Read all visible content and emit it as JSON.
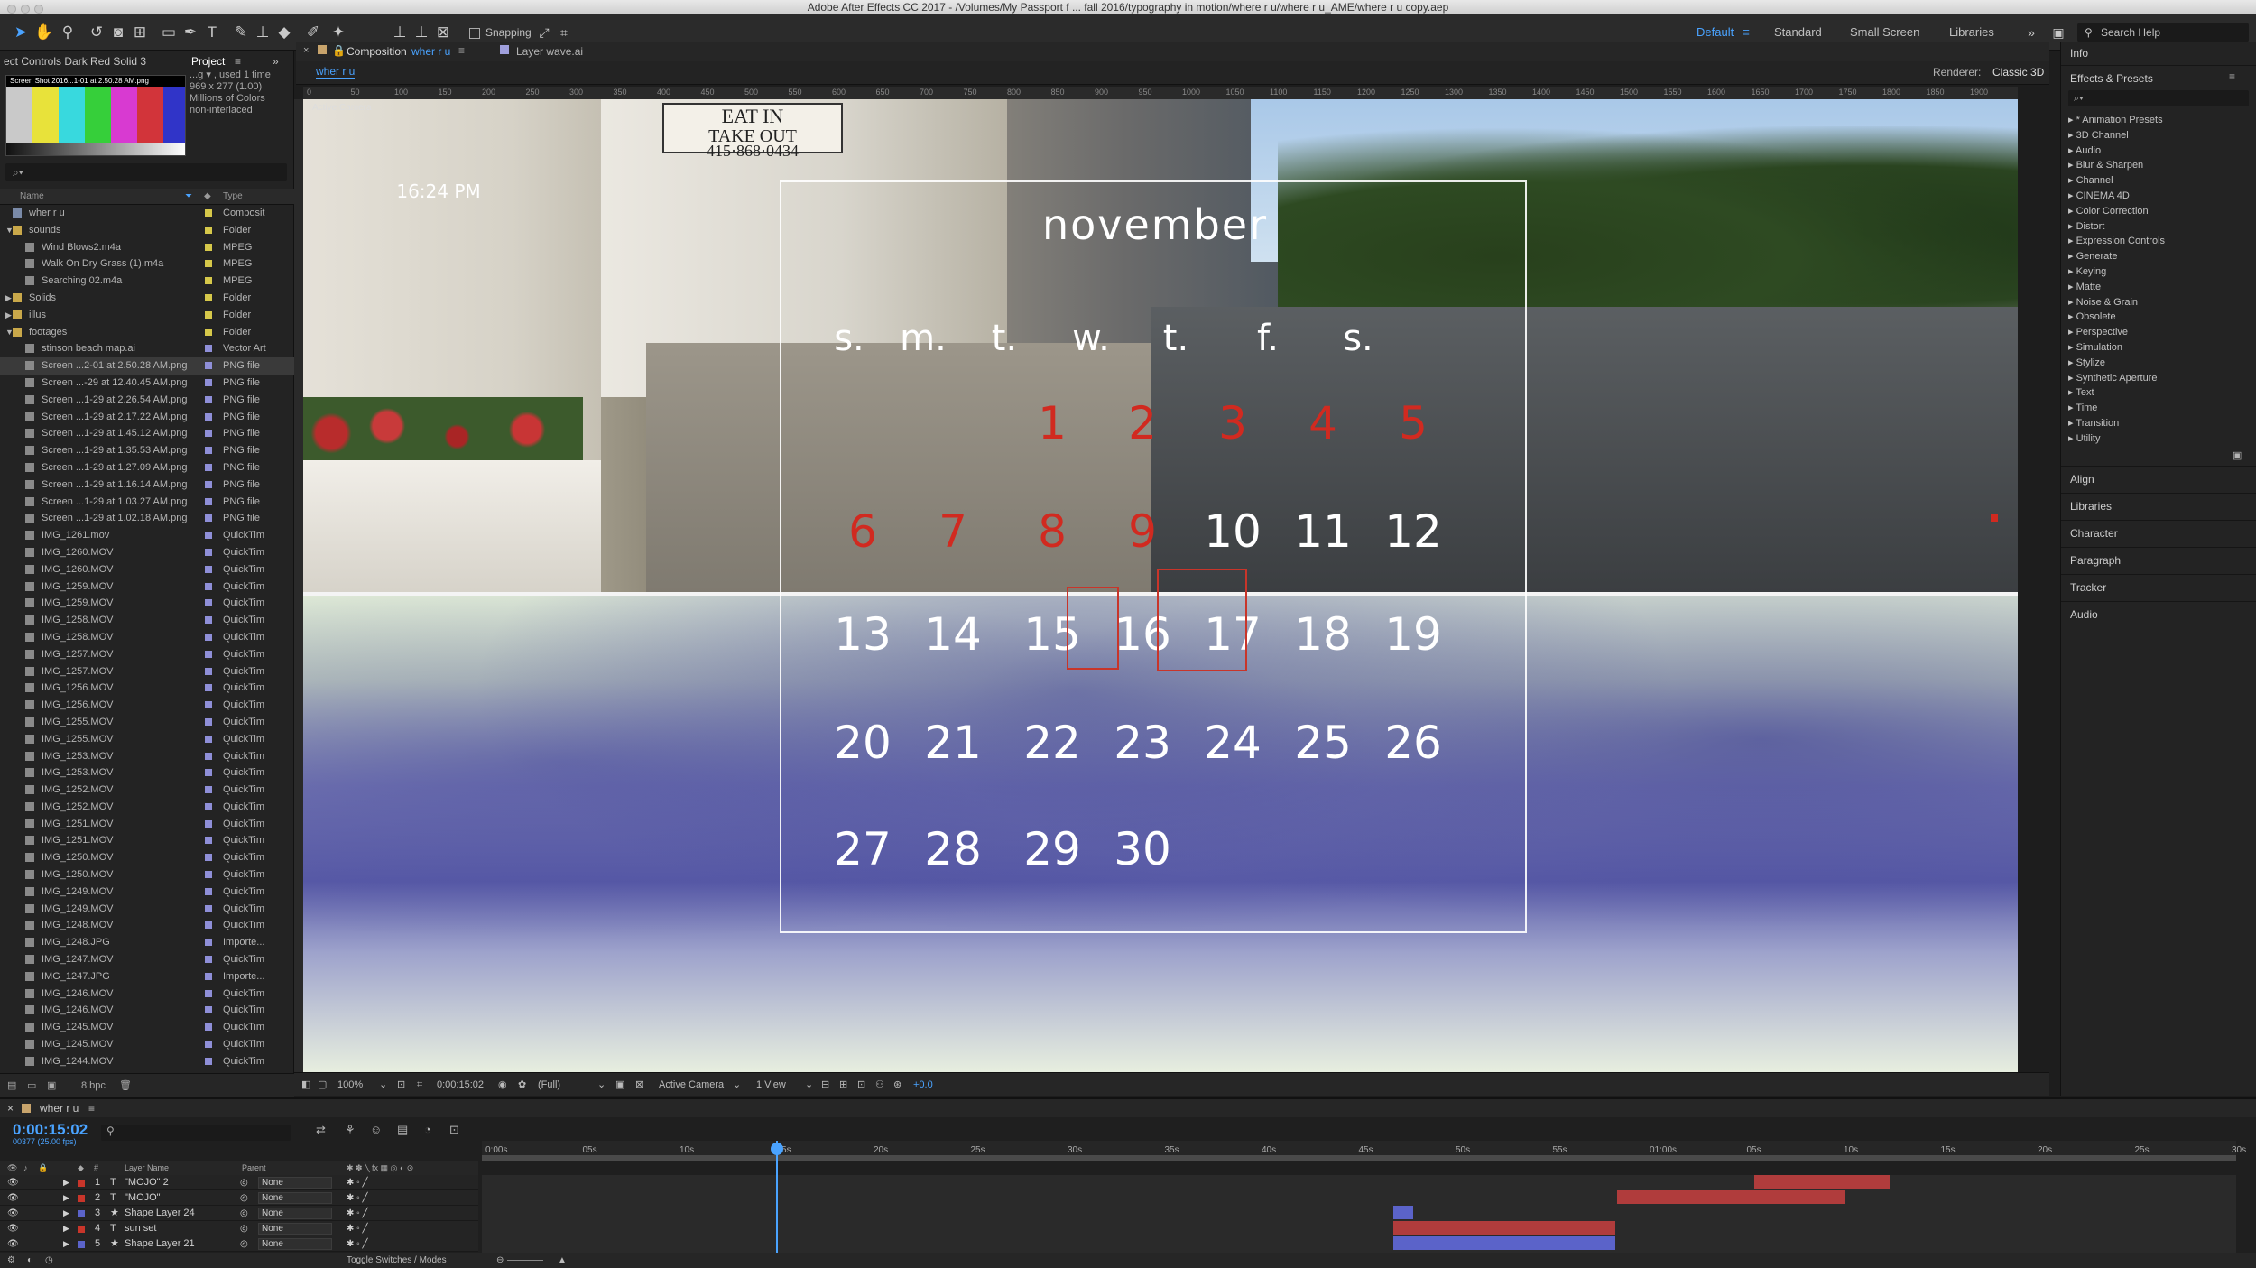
{
  "titlebar": {
    "title": "Adobe After Effects CC 2017 - /Volumes/My Passport f ... fall 2016/typography in motion/where r u/where r u_AME/where r u copy.aep"
  },
  "toolbar": {
    "snapping_label": "Snapping",
    "workspaces": [
      "Default",
      "Standard",
      "Small Screen",
      "Libraries"
    ],
    "active_workspace": "Default",
    "search_placeholder": "Search Help"
  },
  "left_panel": {
    "effect_controls_tab": "ect Controls Dark Red Solid 3",
    "project_tab": "Project",
    "thumb_name": "Screen Shot 2016...1-01 at 2.50.28 AM.png",
    "info_lines": [
      "...g ▾ , used 1 time",
      "969 x 277 (1.00)",
      "",
      "Millions of Colors",
      "non-interlaced"
    ],
    "search_placeholder": "⌕▾",
    "col_name": "Name",
    "col_type": "Type",
    "bpc": "8 bpc",
    "items": [
      {
        "name": "wher r u",
        "type": "Composit",
        "color": "#d6c84a",
        "icon": "comp-icon",
        "indent": 0,
        "twirl": ""
      },
      {
        "name": "sounds",
        "type": "Folder",
        "color": "#d6c84a",
        "icon": "folder-icon",
        "indent": 0,
        "twirl": "▼"
      },
      {
        "name": "Wind Blows2.m4a",
        "type": "MPEG",
        "color": "#d6c84a",
        "icon": "audio-icon",
        "indent": 1,
        "twirl": ""
      },
      {
        "name": "Walk On Dry Grass (1).m4a",
        "type": "MPEG",
        "color": "#d6c84a",
        "icon": "audio-icon",
        "indent": 1,
        "twirl": ""
      },
      {
        "name": "Searching 02.m4a",
        "type": "MPEG",
        "color": "#d6c84a",
        "icon": "audio-icon",
        "indent": 1,
        "twirl": ""
      },
      {
        "name": "Solids",
        "type": "Folder",
        "color": "#d6c84a",
        "icon": "folder-icon",
        "indent": 0,
        "twirl": "▶"
      },
      {
        "name": "illus",
        "type": "Folder",
        "color": "#d6c84a",
        "icon": "folder-icon",
        "indent": 0,
        "twirl": "▶"
      },
      {
        "name": "footages",
        "type": "Folder",
        "color": "#d6c84a",
        "icon": "folder-icon",
        "indent": 0,
        "twirl": "▼"
      },
      {
        "name": "stinson beach map.ai",
        "type": "Vector Art",
        "color": "#8f8fd8",
        "icon": "vector-icon",
        "indent": 1,
        "twirl": ""
      },
      {
        "name": "Screen ...2-01 at 2.50.28 AM.png",
        "type": "PNG file",
        "color": "#8f8fd8",
        "icon": "image-icon",
        "indent": 1,
        "twirl": "",
        "hl": true
      },
      {
        "name": "Screen ...-29 at 12.40.45 AM.png",
        "type": "PNG file",
        "color": "#8f8fd8",
        "icon": "image-icon",
        "indent": 1,
        "twirl": ""
      },
      {
        "name": "Screen ...1-29 at 2.26.54 AM.png",
        "type": "PNG file",
        "color": "#8f8fd8",
        "icon": "image-icon",
        "indent": 1,
        "twirl": ""
      },
      {
        "name": "Screen ...1-29 at 2.17.22 AM.png",
        "type": "PNG file",
        "color": "#8f8fd8",
        "icon": "image-icon",
        "indent": 1,
        "twirl": ""
      },
      {
        "name": "Screen ...1-29 at 1.45.12 AM.png",
        "type": "PNG file",
        "color": "#8f8fd8",
        "icon": "image-icon",
        "indent": 1,
        "twirl": ""
      },
      {
        "name": "Screen ...1-29 at 1.35.53 AM.png",
        "type": "PNG file",
        "color": "#8f8fd8",
        "icon": "image-icon",
        "indent": 1,
        "twirl": ""
      },
      {
        "name": "Screen ...1-29 at 1.27.09 AM.png",
        "type": "PNG file",
        "color": "#8f8fd8",
        "icon": "image-icon",
        "indent": 1,
        "twirl": ""
      },
      {
        "name": "Screen ...1-29 at 1.16.14 AM.png",
        "type": "PNG file",
        "color": "#8f8fd8",
        "icon": "image-icon",
        "indent": 1,
        "twirl": ""
      },
      {
        "name": "Screen ...1-29 at 1.03.27 AM.png",
        "type": "PNG file",
        "color": "#8f8fd8",
        "icon": "image-icon",
        "indent": 1,
        "twirl": ""
      },
      {
        "name": "Screen ...1-29 at 1.02.18 AM.png",
        "type": "PNG file",
        "color": "#8f8fd8",
        "icon": "image-icon",
        "indent": 1,
        "twirl": ""
      },
      {
        "name": "IMG_1261.mov",
        "type": "QuickTim",
        "color": "#8f8fd8",
        "icon": "video-icon",
        "indent": 1,
        "twirl": ""
      },
      {
        "name": "IMG_1260.MOV",
        "type": "QuickTim",
        "color": "#8f8fd8",
        "icon": "video-icon",
        "indent": 1,
        "twirl": ""
      },
      {
        "name": "IMG_1260.MOV",
        "type": "QuickTim",
        "color": "#8f8fd8",
        "icon": "video-icon",
        "indent": 1,
        "twirl": ""
      },
      {
        "name": "IMG_1259.MOV",
        "type": "QuickTim",
        "color": "#8f8fd8",
        "icon": "video-icon",
        "indent": 1,
        "twirl": ""
      },
      {
        "name": "IMG_1259.MOV",
        "type": "QuickTim",
        "color": "#8f8fd8",
        "icon": "video-icon",
        "indent": 1,
        "twirl": ""
      },
      {
        "name": "IMG_1258.MOV",
        "type": "QuickTim",
        "color": "#8f8fd8",
        "icon": "video-icon",
        "indent": 1,
        "twirl": ""
      },
      {
        "name": "IMG_1258.MOV",
        "type": "QuickTim",
        "color": "#8f8fd8",
        "icon": "video-icon",
        "indent": 1,
        "twirl": ""
      },
      {
        "name": "IMG_1257.MOV",
        "type": "QuickTim",
        "color": "#8f8fd8",
        "icon": "video-icon",
        "indent": 1,
        "twirl": ""
      },
      {
        "name": "IMG_1257.MOV",
        "type": "QuickTim",
        "color": "#8f8fd8",
        "icon": "video-icon",
        "indent": 1,
        "twirl": ""
      },
      {
        "name": "IMG_1256.MOV",
        "type": "QuickTim",
        "color": "#8f8fd8",
        "icon": "video-icon",
        "indent": 1,
        "twirl": ""
      },
      {
        "name": "IMG_1256.MOV",
        "type": "QuickTim",
        "color": "#8f8fd8",
        "icon": "video-icon",
        "indent": 1,
        "twirl": ""
      },
      {
        "name": "IMG_1255.MOV",
        "type": "QuickTim",
        "color": "#8f8fd8",
        "icon": "video-icon",
        "indent": 1,
        "twirl": ""
      },
      {
        "name": "IMG_1255.MOV",
        "type": "QuickTim",
        "color": "#8f8fd8",
        "icon": "video-icon",
        "indent": 1,
        "twirl": ""
      },
      {
        "name": "IMG_1253.MOV",
        "type": "QuickTim",
        "color": "#8f8fd8",
        "icon": "video-icon",
        "indent": 1,
        "twirl": ""
      },
      {
        "name": "IMG_1253.MOV",
        "type": "QuickTim",
        "color": "#8f8fd8",
        "icon": "video-icon",
        "indent": 1,
        "twirl": ""
      },
      {
        "name": "IMG_1252.MOV",
        "type": "QuickTim",
        "color": "#8f8fd8",
        "icon": "video-icon",
        "indent": 1,
        "twirl": ""
      },
      {
        "name": "IMG_1252.MOV",
        "type": "QuickTim",
        "color": "#8f8fd8",
        "icon": "video-icon",
        "indent": 1,
        "twirl": ""
      },
      {
        "name": "IMG_1251.MOV",
        "type": "QuickTim",
        "color": "#8f8fd8",
        "icon": "video-icon",
        "indent": 1,
        "twirl": ""
      },
      {
        "name": "IMG_1251.MOV",
        "type": "QuickTim",
        "color": "#8f8fd8",
        "icon": "video-icon",
        "indent": 1,
        "twirl": ""
      },
      {
        "name": "IMG_1250.MOV",
        "type": "QuickTim",
        "color": "#8f8fd8",
        "icon": "video-icon",
        "indent": 1,
        "twirl": ""
      },
      {
        "name": "IMG_1250.MOV",
        "type": "QuickTim",
        "color": "#8f8fd8",
        "icon": "video-icon",
        "indent": 1,
        "twirl": ""
      },
      {
        "name": "IMG_1249.MOV",
        "type": "QuickTim",
        "color": "#8f8fd8",
        "icon": "video-icon",
        "indent": 1,
        "twirl": ""
      },
      {
        "name": "IMG_1249.MOV",
        "type": "QuickTim",
        "color": "#8f8fd8",
        "icon": "video-icon",
        "indent": 1,
        "twirl": ""
      },
      {
        "name": "IMG_1248.MOV",
        "type": "QuickTim",
        "color": "#8f8fd8",
        "icon": "video-icon",
        "indent": 1,
        "twirl": ""
      },
      {
        "name": "IMG_1248.JPG",
        "type": "Importe...",
        "color": "#8f8fd8",
        "icon": "image-icon",
        "indent": 1,
        "twirl": ""
      },
      {
        "name": "IMG_1247.MOV",
        "type": "QuickTim",
        "color": "#8f8fd8",
        "icon": "video-icon",
        "indent": 1,
        "twirl": ""
      },
      {
        "name": "IMG_1247.JPG",
        "type": "Importe...",
        "color": "#8f8fd8",
        "icon": "image-icon",
        "indent": 1,
        "twirl": ""
      },
      {
        "name": "IMG_1246.MOV",
        "type": "QuickTim",
        "color": "#8f8fd8",
        "icon": "video-icon",
        "indent": 1,
        "twirl": ""
      },
      {
        "name": "IMG_1246.MOV",
        "type": "QuickTim",
        "color": "#8f8fd8",
        "icon": "video-icon",
        "indent": 1,
        "twirl": ""
      },
      {
        "name": "IMG_1245.MOV",
        "type": "QuickTim",
        "color": "#8f8fd8",
        "icon": "video-icon",
        "indent": 1,
        "twirl": ""
      },
      {
        "name": "IMG_1245.MOV",
        "type": "QuickTim",
        "color": "#8f8fd8",
        "icon": "video-icon",
        "indent": 1,
        "twirl": ""
      },
      {
        "name": "IMG_1244.MOV",
        "type": "QuickTim",
        "color": "#8f8fd8",
        "icon": "video-icon",
        "indent": 1,
        "twirl": ""
      }
    ]
  },
  "comp_panel": {
    "tab_label": "Composition",
    "comp_name": "wher r u",
    "layer_tab": "Layer wave.ai",
    "sub_tab": "wher r u",
    "renderer_label": "Renderer:",
    "renderer_value": "Classic 3D",
    "active_camera_label": "Active Camera",
    "ruler_ticks": [
      "0",
      "50",
      "100",
      "150",
      "200",
      "250",
      "300",
      "350",
      "400",
      "450",
      "500",
      "550",
      "600",
      "650",
      "700",
      "750",
      "800",
      "850",
      "900",
      "950",
      "1000",
      "1050",
      "1100",
      "1150",
      "1200",
      "1250",
      "1300",
      "1350",
      "1400",
      "1450",
      "1500",
      "1550",
      "1600",
      "1650",
      "1700",
      "1750",
      "1800",
      "1850",
      "1900"
    ],
    "footer": {
      "zoom": "100%",
      "timecode": "0:00:15:02",
      "resolution": "(Full)",
      "camera": "Active Camera",
      "views": "1 View",
      "exposure": "+0.0"
    }
  },
  "scene": {
    "clock": "16:24 PM",
    "sign_lines": [
      "EAT IN",
      "TAKE OUT",
      "415·868·0434"
    ],
    "month": "november",
    "weekdays": [
      "s.",
      "m.",
      "t.",
      "w.",
      "t.",
      "f.",
      "s."
    ],
    "weeks": [
      [
        {
          "d": "",
          "red": false
        },
        {
          "d": "",
          "red": false
        },
        {
          "d": "1",
          "red": true
        },
        {
          "d": "2",
          "red": true
        },
        {
          "d": "3",
          "red": true
        },
        {
          "d": "4",
          "red": true
        },
        {
          "d": "5",
          "red": true
        }
      ],
      [
        {
          "d": "6",
          "red": true
        },
        {
          "d": "7",
          "red": true
        },
        {
          "d": "8",
          "red": true
        },
        {
          "d": "9",
          "red": true
        },
        {
          "d": "10",
          "red": false
        },
        {
          "d": "11",
          "red": false
        },
        {
          "d": "12",
          "red": false
        }
      ],
      [
        {
          "d": "13",
          "red": false
        },
        {
          "d": "14",
          "red": false
        },
        {
          "d": "15",
          "red": false
        },
        {
          "d": "16",
          "red": false
        },
        {
          "d": "17",
          "red": false
        },
        {
          "d": "18",
          "red": false
        },
        {
          "d": "19",
          "red": false
        }
      ],
      [
        {
          "d": "20",
          "red": false
        },
        {
          "d": "21",
          "red": false
        },
        {
          "d": "22",
          "red": false
        },
        {
          "d": "23",
          "red": false
        },
        {
          "d": "24",
          "red": false
        },
        {
          "d": "25",
          "red": false
        },
        {
          "d": "26",
          "red": false
        }
      ],
      [
        {
          "d": "27",
          "red": false
        },
        {
          "d": "28",
          "red": false
        },
        {
          "d": "29",
          "red": false
        },
        {
          "d": "30",
          "red": false
        },
        {
          "d": "",
          "red": false
        },
        {
          "d": "",
          "red": false
        },
        {
          "d": "",
          "red": false
        }
      ]
    ],
    "red_color": "#d12a20"
  },
  "right_panel": {
    "info": "Info",
    "effects_title": "Effects & Presets",
    "search_placeholder": "⌕▾",
    "effects": [
      "* Animation Presets",
      "3D Channel",
      "Audio",
      "Blur & Sharpen",
      "Channel",
      "CINEMA 4D",
      "Color Correction",
      "Distort",
      "Expression Controls",
      "Generate",
      "Keying",
      "Matte",
      "Noise & Grain",
      "Obsolete",
      "Perspective",
      "Simulation",
      "Stylize",
      "Synthetic Aperture",
      "Text",
      "Time",
      "Transition",
      "Utility"
    ],
    "sections": [
      "Align",
      "Libraries",
      "Character",
      "Paragraph",
      "Tracker",
      "Audio"
    ]
  },
  "timeline": {
    "tab": "wher r u",
    "timecode": "0:00:15:02",
    "fps": "00377 (25.00 fps)",
    "col_layer_name": "Layer Name",
    "col_parent": "Parent",
    "ruler": [
      "0:00s",
      "05s",
      "10s",
      "15s",
      "20s",
      "25s",
      "30s",
      "35s",
      "40s",
      "45s",
      "50s",
      "55s",
      "01:00s",
      "05s",
      "10s",
      "15s",
      "20s",
      "25s",
      "30s"
    ],
    "layers": [
      {
        "num": "1",
        "type": "T",
        "name": "\"MOJO\" 2",
        "label": "#c8352a",
        "parent": "None"
      },
      {
        "num": "2",
        "type": "T",
        "name": "\"MOJO\"",
        "label": "#c8352a",
        "parent": "None"
      },
      {
        "num": "3",
        "type": "★",
        "name": "Shape Layer 24",
        "label": "#5b63c9",
        "parent": "None"
      },
      {
        "num": "4",
        "type": "T",
        "name": "sun set",
        "label": "#c8352a",
        "parent": "None"
      },
      {
        "num": "5",
        "type": "★",
        "name": "Shape Layer 21",
        "label": "#5b63c9",
        "parent": "None"
      }
    ],
    "toggle_label": "Toggle Switches / Modes"
  }
}
